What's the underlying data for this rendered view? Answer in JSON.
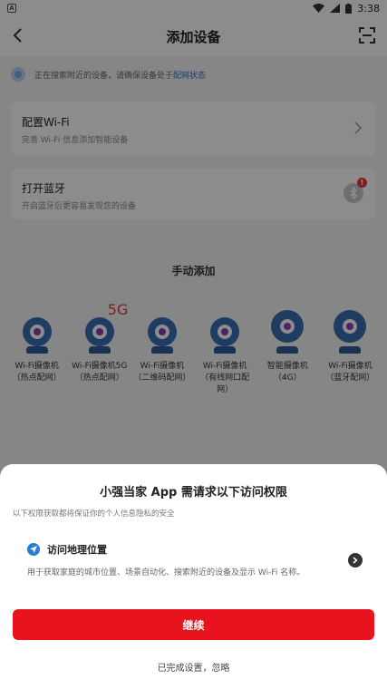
{
  "status_bar": {
    "time": "3:38",
    "app_icon_letter": "A"
  },
  "header": {
    "title": "添加设备",
    "back_icon": "back-arrow-icon",
    "scan_icon": "scan-icon"
  },
  "search_hint": {
    "text": "正在搜索附近的设备，请确保设备处于",
    "link": "配网状态"
  },
  "cards": {
    "wifi": {
      "title": "配置Wi-Fi",
      "subtitle": "完善 Wi-Fi 信息添加智能设备"
    },
    "bluetooth": {
      "title": "打开蓝牙",
      "subtitle": "开启蓝牙后更容易发现您的设备",
      "badge": "!"
    }
  },
  "manual": {
    "title": "手动添加",
    "badge_5g": "5G",
    "devices": [
      {
        "label": "Wi-Fi摄像机（热点配网）"
      },
      {
        "label": "Wi-Fi摄像机5G（热点配网）"
      },
      {
        "label": "Wi-Fi摄像机（二维码配网）"
      },
      {
        "label": "Wi-Fi摄像机（有线网口配网）"
      },
      {
        "label": "智能摄像机（4G）"
      },
      {
        "label": "Wi-Fi摄像机（蓝牙配网）"
      }
    ]
  },
  "sheet": {
    "title": "小强当家 App 需请求以下访问权限",
    "subtitle": "以下权限获取都将保证你的个人信息隐私的安全",
    "permission": {
      "name": "访问地理位置",
      "description": "用于获取家庭的城市位置、场景自动化、搜索附近的设备及显示 Wi-Fi 名称。"
    },
    "continue_label": "继续",
    "ignore_label": "已完成设置，忽略"
  },
  "colors": {
    "accent": "#e8131c",
    "link": "#2b6fd6",
    "camera": "#3a6db4"
  }
}
